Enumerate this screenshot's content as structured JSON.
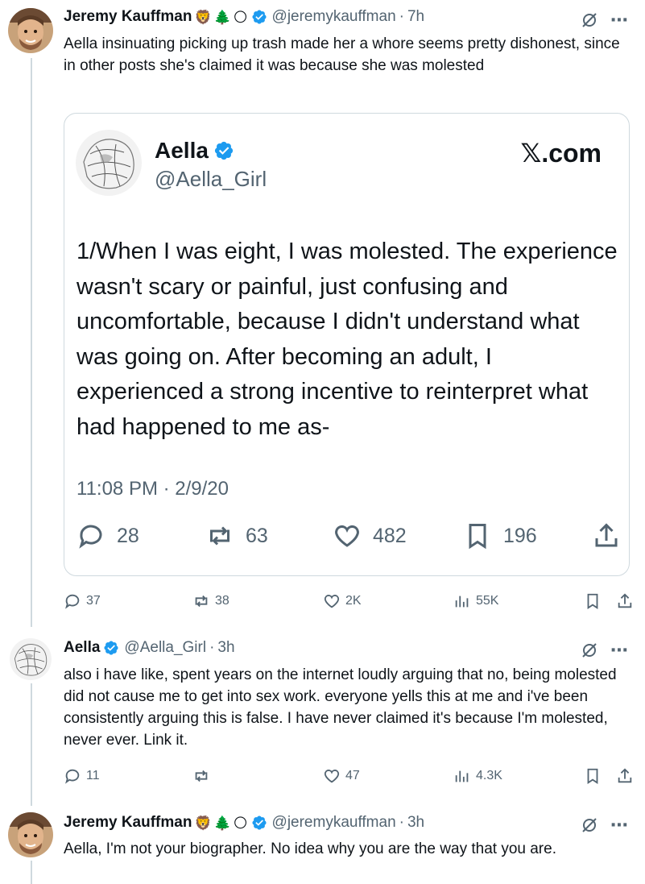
{
  "tweets": [
    {
      "author": "Jeremy Kauffman",
      "emojis": [
        "🦁",
        "🌲",
        "🌕"
      ],
      "handle": "@jeremykauffman",
      "time": "7h",
      "text": "Aella insinuating picking up trash made her a whore seems pretty dishonest, since in other posts she's claimed it was because she was molested",
      "quote": {
        "author": "Aella",
        "handle": "@Aella_Girl",
        "site": "𝕏.com",
        "body": "1/When I was eight, I was molested. The experience wasn't scary or painful, just confusing and uncomfortable, because I didn't understand what was going on. After becoming an adult, I experienced a strong incentive to reinterpret what had happened to me as-",
        "date": "11:08 PM · 2/9/20",
        "replies": "28",
        "reposts": "63",
        "likes": "482",
        "bookmarks": "196"
      },
      "stats": {
        "replies": "37",
        "reposts": "38",
        "likes": "2K",
        "views": "55K"
      }
    },
    {
      "author": "Aella",
      "handle": "@Aella_Girl",
      "time": "3h",
      "text": "also i have like, spent years on the internet loudly arguing that no, being molested did not cause me to get into sex work. everyone yells this at me and i've been consistently arguing this is false. I have never claimed it's because I'm molested, never ever. Link it.",
      "stats": {
        "replies": "11",
        "reposts": "",
        "likes": "47",
        "views": "4.3K"
      }
    },
    {
      "author": "Jeremy Kauffman",
      "emojis": [
        "🦁",
        "🌲",
        "🌕"
      ],
      "handle": "@jeremykauffman",
      "time": "3h",
      "text": "Aella, I'm not your biographer. No idea why you are the way that you are."
    }
  ],
  "separator": "·",
  "colors": {
    "verified": "#1d9bf0",
    "muted": "#536471",
    "text": "#0f1419",
    "line": "#cfd9de"
  },
  "icons": [
    "reply-icon",
    "repost-icon",
    "like-icon",
    "views-icon",
    "bookmark-icon",
    "share-icon",
    "grok-icon",
    "more-icon",
    "verified-icon"
  ]
}
